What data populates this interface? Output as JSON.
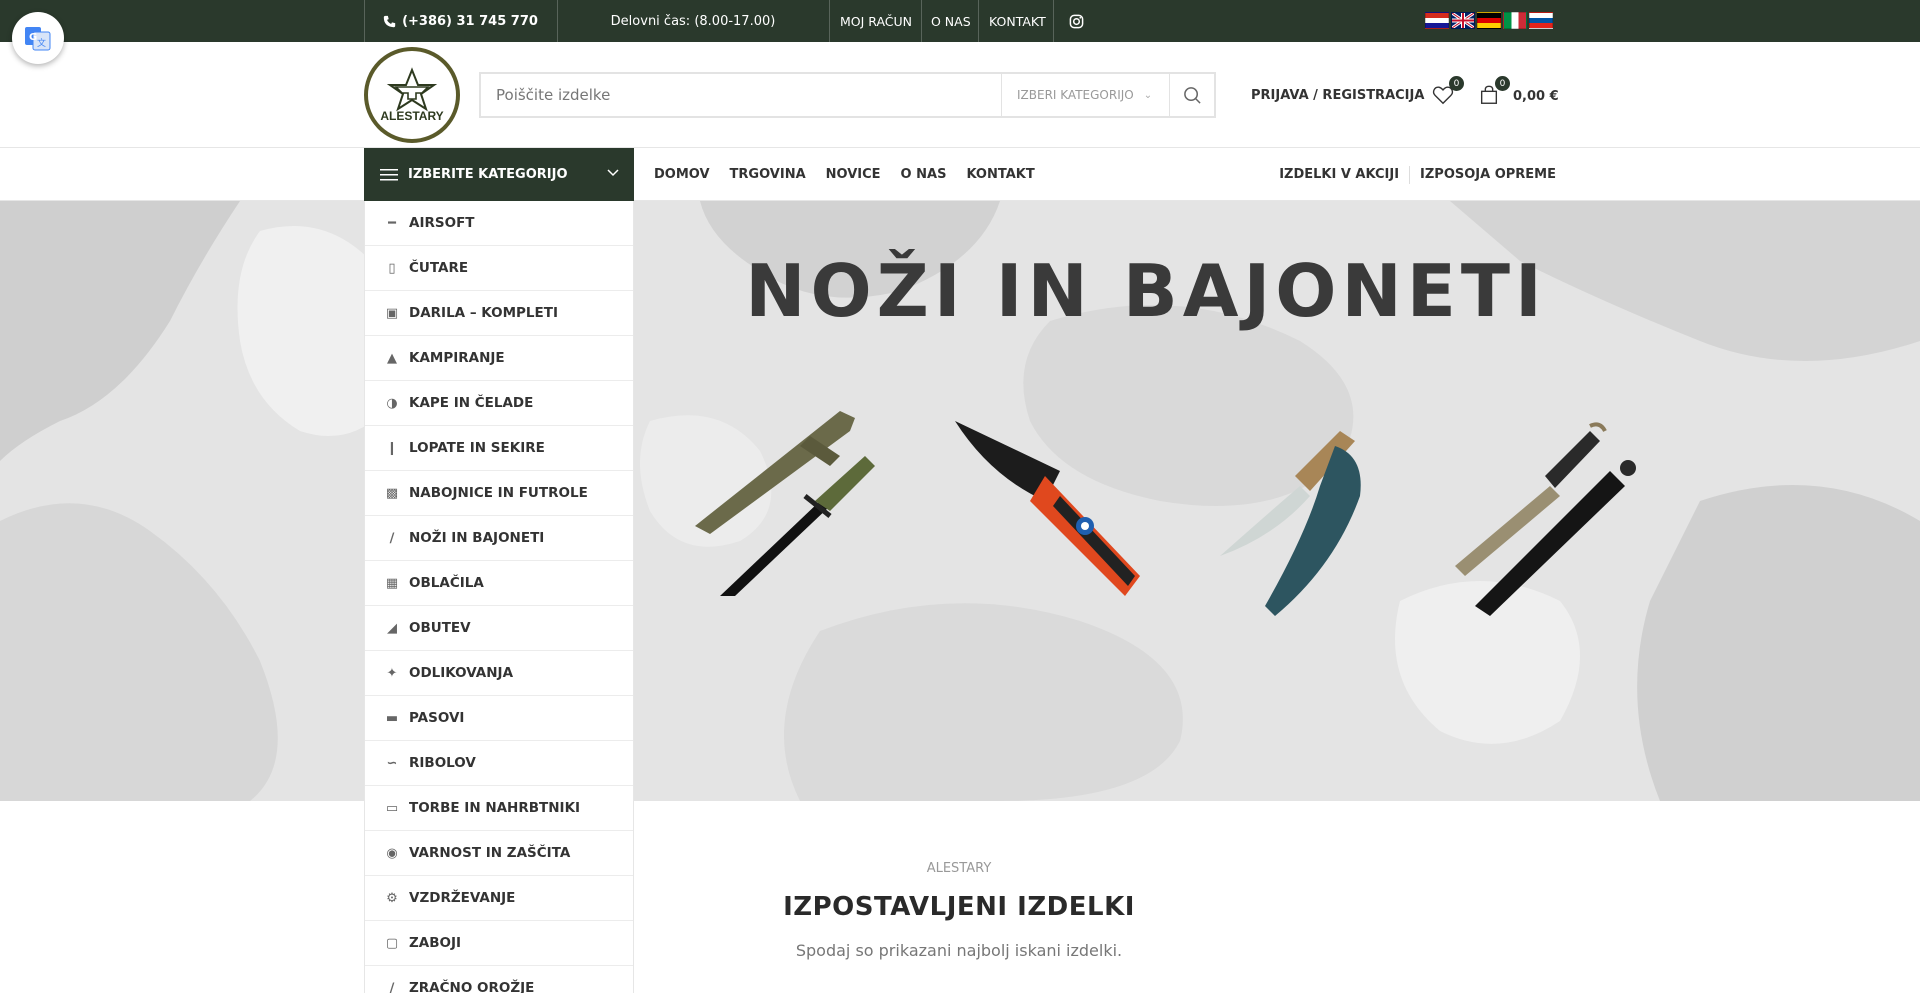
{
  "topbar": {
    "phone": "(+386) 31 745 770",
    "hours": "Delovni čas: (8.00-17.00)",
    "links": [
      "MOJ RAČUN",
      "O NAS",
      "KONTAKT"
    ],
    "flags": [
      "croatian-flag",
      "english-flag",
      "german-flag",
      "italian-flag",
      "slovenian-flag"
    ]
  },
  "header": {
    "logo_text": "ALESTARY",
    "search_placeholder": "Poiščite izdelke",
    "category_select": "IZBERI KATEGORIJO",
    "login": "PRIJAVA / REGISTRACIJA",
    "wishlist_count": "0",
    "cart_count": "0",
    "cart_total": "0,00 €"
  },
  "nav": {
    "category_toggle": "IZBERITE KATEGORIJO",
    "main": [
      "DOMOV",
      "TRGOVINA",
      "NOVICE",
      "O NAS",
      "KONTAKT"
    ],
    "right": [
      "IZDELKI V AKCIJI",
      "IZPOSOJA OPREME"
    ]
  },
  "categories": [
    {
      "label": "AIRSOFT",
      "icon": "gun-icon"
    },
    {
      "label": "ČUTARE",
      "icon": "canteen-icon"
    },
    {
      "label": "DARILA – KOMPLETI",
      "icon": "gift-icon"
    },
    {
      "label": "KAMPIRANJE",
      "icon": "campfire-icon"
    },
    {
      "label": "KAPE IN ČELADE",
      "icon": "helmet-icon"
    },
    {
      "label": "LOPATE IN SEKIRE",
      "icon": "shovel-icon"
    },
    {
      "label": "NABOJNICE IN FUTROLE",
      "icon": "holster-icon"
    },
    {
      "label": "NOŽI IN BAJONETI",
      "icon": "knife-icon"
    },
    {
      "label": "OBLAČILA",
      "icon": "clothing-icon"
    },
    {
      "label": "OBUTEV",
      "icon": "boot-icon"
    },
    {
      "label": "ODLIKOVANJA",
      "icon": "medal-icon"
    },
    {
      "label": "PASOVI",
      "icon": "belt-icon"
    },
    {
      "label": "RIBOLOV",
      "icon": "fishing-icon"
    },
    {
      "label": "TORBE IN NAHRBTNIKI",
      "icon": "backpack-icon"
    },
    {
      "label": "VARNOST IN ZAŠČITA",
      "icon": "gas-mask-icon"
    },
    {
      "label": "VZDRŽEVANJE",
      "icon": "maintenance-icon"
    },
    {
      "label": "ZABOJI",
      "icon": "crate-icon"
    },
    {
      "label": "ZRAČNO OROŽJE",
      "icon": "air-gun-icon"
    }
  ],
  "hero": {
    "title": "NOŽI IN BAJONETI"
  },
  "featured": {
    "kicker": "ALESTARY",
    "title": "IZPOSTAVLJENI IZDELKI",
    "subtitle": "Spodaj so prikazani najbolj iskani izdelki."
  }
}
